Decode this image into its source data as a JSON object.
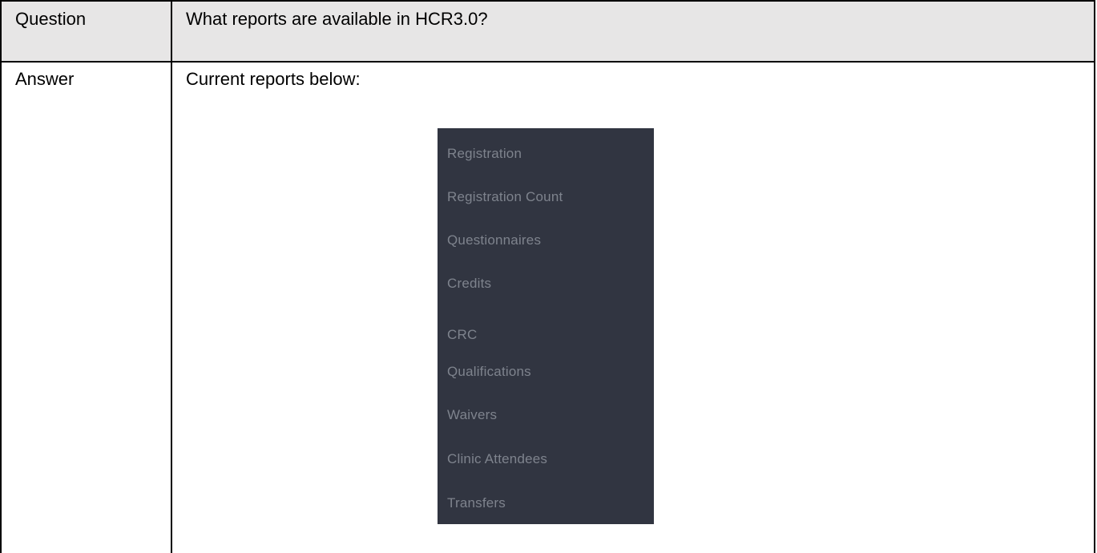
{
  "table": {
    "question_label": "Question",
    "question_text": "What reports are available in HCR3.0?",
    "answer_label": "Answer",
    "answer_intro": "Current reports below:"
  },
  "reports_menu": {
    "items": [
      {
        "label": "Registration"
      },
      {
        "label": "Registration Count"
      },
      {
        "label": "Questionnaires"
      },
      {
        "label": "Credits"
      },
      {
        "label": "CRC"
      },
      {
        "label": "Qualifications"
      },
      {
        "label": "Waivers"
      },
      {
        "label": "Clinic Attendees"
      },
      {
        "label": "Transfers"
      }
    ],
    "colors": {
      "background": "#313541",
      "text": "#7e838d"
    }
  },
  "colors": {
    "header_row_background": "#e7e6e6",
    "border": "#000000"
  }
}
